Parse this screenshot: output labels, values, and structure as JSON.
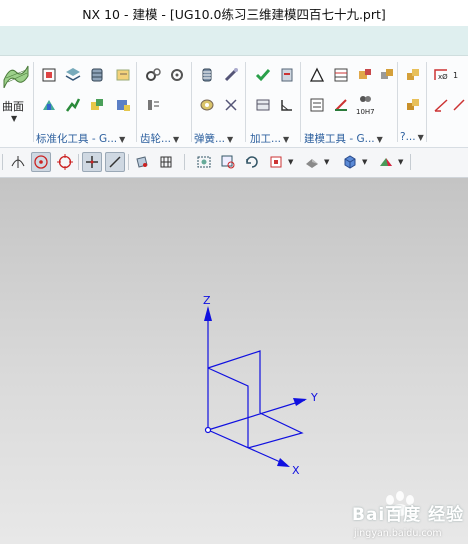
{
  "window": {
    "title": "NX 10 - 建模 - [UG10.0练习三维建模四百七十九.prt]"
  },
  "ribbon": {
    "surface_group": {
      "label": "曲面",
      "icon": "surface-icon"
    },
    "groups": [
      {
        "label": "标准化工具 - G...",
        "id": "standardization-tools"
      },
      {
        "label": "齿轮...",
        "id": "gear"
      },
      {
        "label": "弹簧...",
        "id": "spring"
      },
      {
        "label": "加工...",
        "id": "machining"
      },
      {
        "label": "建模工具 - G...",
        "id": "modeling-tools"
      },
      {
        "label": "?...",
        "id": "dimension"
      }
    ],
    "accent_color": "#2c5f9e"
  },
  "viewport": {
    "axis_labels": {
      "z": "Z",
      "y": "Y",
      "x": "X"
    },
    "axis_color": "#1010e0"
  },
  "watermark": {
    "brand": "Bai百度 经验",
    "url": "jingyan.baidu.com"
  }
}
